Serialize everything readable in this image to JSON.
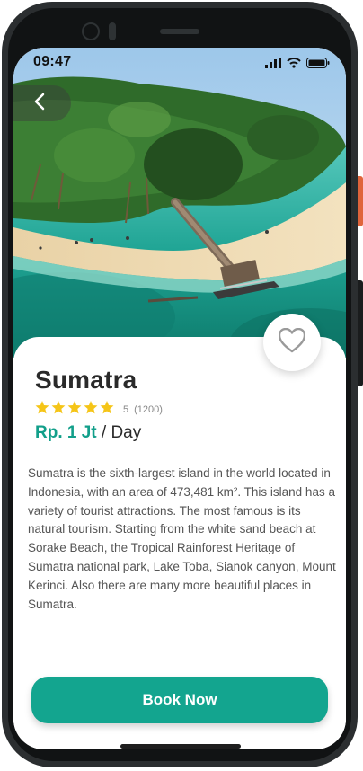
{
  "status_bar": {
    "time": "09:47"
  },
  "place": {
    "name": "Sumatra",
    "rating": "5",
    "rating_count": "(1200)",
    "price_amount": "Rp. 1 Jt",
    "price_unit": "/ Day",
    "description": "Sumatra is the sixth-largest island in the world located in Indonesia, with an area of 473,481 km². This island has a variety of tourist attractions. The most famous is its natural tourism. Starting from the white sand beach at Sorake Beach, the Tropical Rainforest Heritage of Sumatra national park, Lake Toba, Sianok canyon, Mount Kerinci. Also there are many more beautiful places in Sumatra."
  },
  "actions": {
    "book_label": "Book Now"
  },
  "icons": {
    "back": "chevron-left-icon",
    "favorite": "heart-outline-icon",
    "star": "star-icon",
    "signal": "signal-icon",
    "wifi": "wifi-icon",
    "battery": "battery-icon"
  },
  "colors": {
    "accent": "#13a58f",
    "price": "#129f8a",
    "star": "#f5c518"
  }
}
